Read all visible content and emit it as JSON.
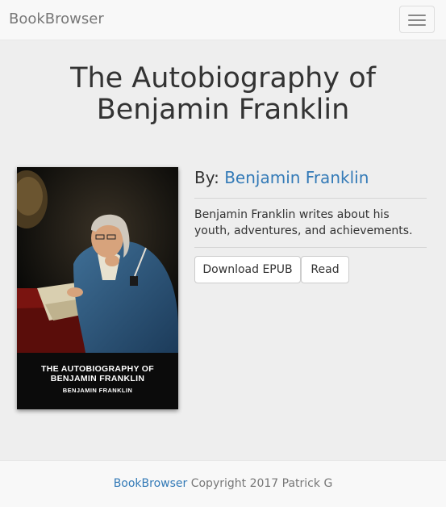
{
  "navbar": {
    "brand": "BookBrowser",
    "toggle_icon": "hamburger-menu-icon"
  },
  "book": {
    "title": "The Autobiography of Benjamin Franklin",
    "by_label": "By:",
    "author": "Benjamin Franklin",
    "description": "Benjamin Franklin writes about his youth, adventures, and achievements.",
    "cover": {
      "title_text": "THE AUTOBIOGRAPHY OF BENJAMIN FRANKLIN",
      "author_text": "BENJAMIN FRANKLIN"
    }
  },
  "actions": {
    "download_label": "Download EPUB",
    "read_label": "Read"
  },
  "footer": {
    "brand_link": "BookBrowser",
    "copyright": "Copyright 2017 Patrick G"
  },
  "colors": {
    "link": "#337ab7",
    "navbar_bg": "#f8f8f8",
    "page_bg": "#eeeeee",
    "cover_bg": "#0b0b0b"
  }
}
